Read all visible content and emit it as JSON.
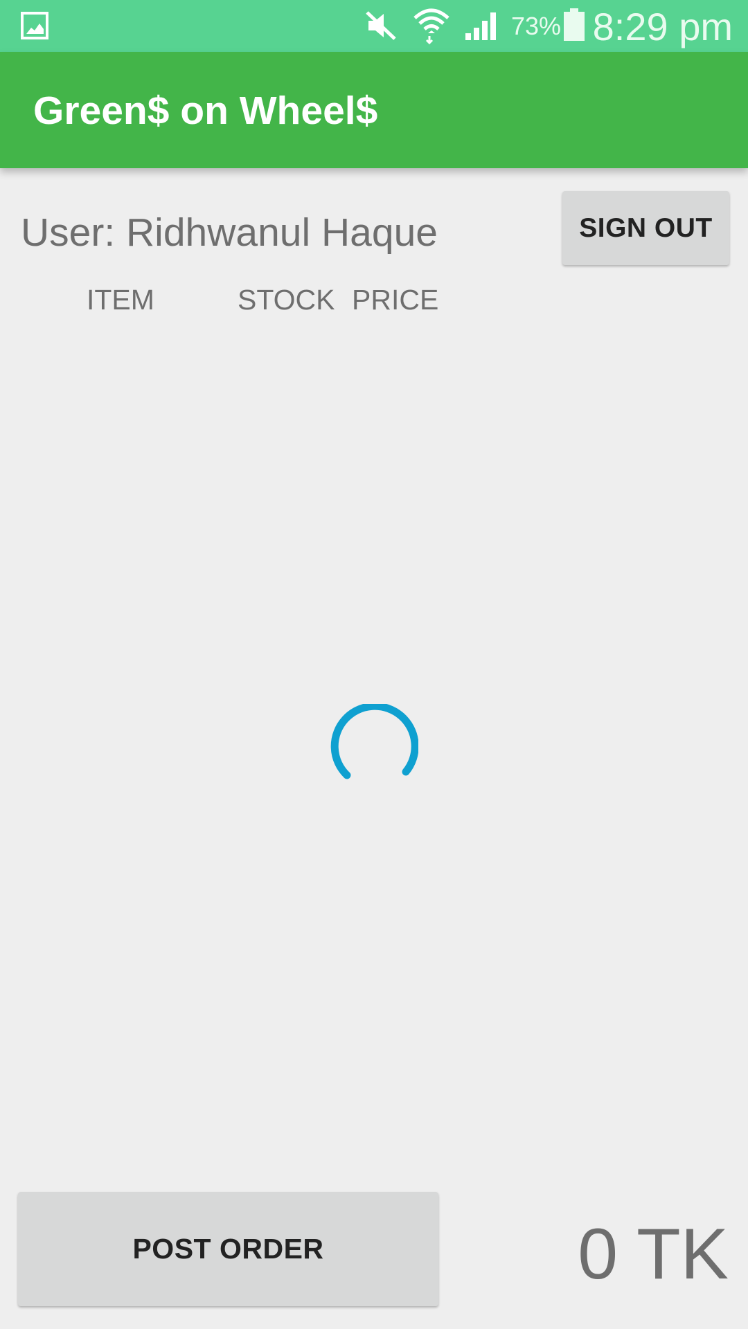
{
  "status_bar": {
    "battery_percent": "73%",
    "time": "8:29 pm",
    "icons": [
      "gallery-icon",
      "mute-icon",
      "wifi-icon",
      "signal-icon",
      "battery-icon"
    ],
    "background_color": "#57d391"
  },
  "app_bar": {
    "title": "Green$ on Wheel$",
    "background_color": "#43b549"
  },
  "header": {
    "user_label": "User: Ridhwanul Haque",
    "sign_out_label": "SIGN OUT"
  },
  "table": {
    "columns": [
      "ITEM",
      "STOCK",
      "PRICE"
    ],
    "rows": []
  },
  "loading": {
    "spinner": "progress-spinner",
    "color": "#0fa0d0"
  },
  "footer": {
    "post_order_label": "POST ORDER",
    "total": "0 TK"
  }
}
